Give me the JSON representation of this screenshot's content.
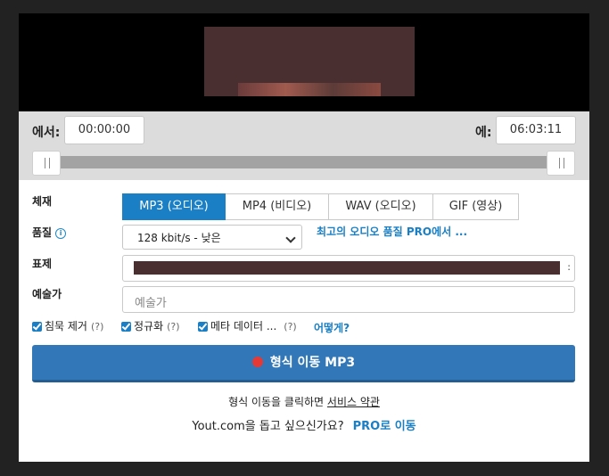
{
  "trim": {
    "from_label": "에서:",
    "from_value": "00:00:00",
    "to_label": "에:",
    "to_value": "06:03:11",
    "range_start": 0,
    "range_end": 1
  },
  "format": {
    "label": "체재",
    "tabs": [
      "MP3 (오디오)",
      "MP4 (비디오)",
      "WAV (오디오)",
      "GIF (영상)"
    ],
    "active": 0
  },
  "quality": {
    "label": "품질",
    "info_icon": "info-icon",
    "selected": "128 kbit/s - 낮은",
    "pro_link": "최고의 오디오 품질 PRO에서 ..."
  },
  "title_field": {
    "label": "표제",
    "value_tail": ":"
  },
  "artist_field": {
    "label": "예술가",
    "placeholder": "예술가"
  },
  "options": {
    "silence": "침묵 제거",
    "normalize": "정규화",
    "metadata": "메타 데이터 ...",
    "help": "(?)",
    "how_link": "어떻게?"
  },
  "convert_button": "형식 이동 MP3",
  "terms": {
    "prefix": "형식 이동을 클릭하면",
    "link": "서비스 약관"
  },
  "promo": {
    "text": "Yout.com을 돕고 싶으신가요?",
    "link": "PRO로 이동"
  },
  "colors": {
    "accent": "#1a7fc4",
    "button": "#3278b8",
    "record_dot": "#e53935"
  }
}
